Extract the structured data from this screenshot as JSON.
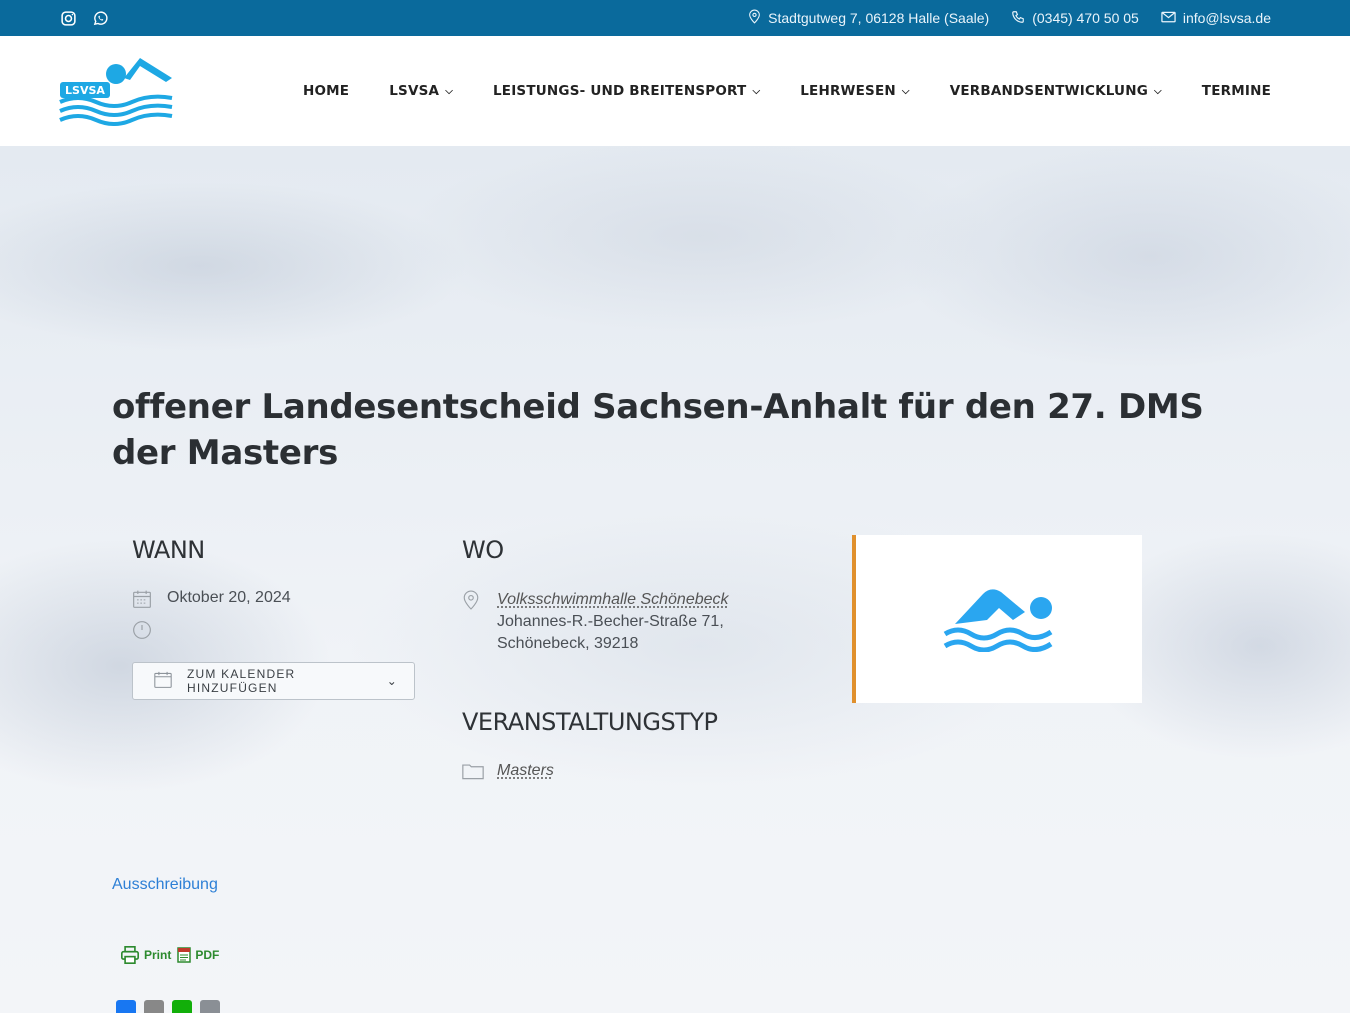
{
  "topbar": {
    "address": "Stadtgutweg 7, 06128 Halle (Saale)",
    "phone": "(0345) 470 50 05",
    "email": "info@lsvsa.de"
  },
  "logo": {
    "text": "LSVSA"
  },
  "nav": {
    "home": "HOME",
    "lsvsa": "LSVSA",
    "leistung": "LEISTUNGS- UND BREITENSPORT",
    "lehrwesen": "LEHRWESEN",
    "verband": "VERBANDSENTWICKLUNG",
    "termine": "TERMINE"
  },
  "event": {
    "title": "offener Landesentscheid Sachsen-Anhalt für den 27. DMS der Masters",
    "when_heading": "WANN",
    "date": "Oktober 20, 2024",
    "calendar_button": "ZUM KALENDER HINZUFÜGEN",
    "where_heading": "WO",
    "venue": "Volksschwimmhalle Schönebeck",
    "street": "Johannes-R.-Becher-Straße 71,",
    "city": "Schönebeck, 39218",
    "type_heading": "VERANSTALTUNGSTYP",
    "type": "Masters"
  },
  "links": {
    "ausschreibung": "Ausschreibung",
    "print": "Print",
    "pdf": "PDF"
  },
  "colors": {
    "topbar": "#0a6a9c",
    "accent": "#e0902d",
    "link": "#2d7fd6",
    "logo_blue": "#1ea8e4"
  }
}
